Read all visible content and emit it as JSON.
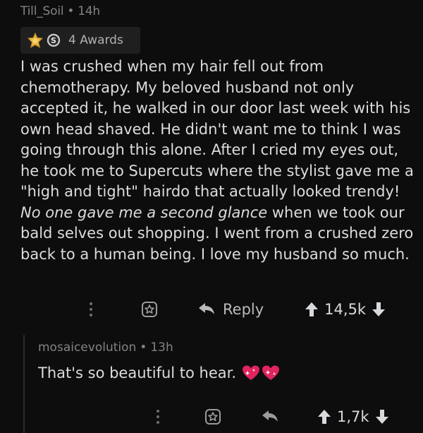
{
  "comment": {
    "author": "Till_Soil",
    "separator": "•",
    "age": "14h",
    "awards_label": "4 Awards",
    "body_part1": "I was crushed when my hair fell out from chemotherapy.  My beloved husband not only accepted it, he walked in our door last week with his own head shaved. He didn't want me to think I was going through this alone. After I cried my eyes out, he took me to Supercuts where the stylist gave me a \"high and tight\" hairdo that actually looked trendy! ",
    "body_italic": "No one gave me a second glance",
    "body_part2": " when we took our bald selves out shopping.  I went from a crushed zero back to a human being.  I love my husband so much.",
    "reply_label": "Reply",
    "score": "14,5k"
  },
  "reply": {
    "author": "mosaicevolution",
    "separator": "•",
    "age": "13h",
    "body": "That's so beautiful to hear.",
    "score": "1,7k"
  },
  "colors": {
    "background": "#0d0d0e",
    "meta_text": "#818384",
    "body_text": "#dcdcdc",
    "heart": "#e0245e"
  },
  "icons": [
    "gold-award-icon",
    "silver-award-icon",
    "more-options-icon",
    "give-award-icon",
    "reply-arrow-icon",
    "upvote-icon",
    "downvote-icon",
    "sparkling-heart-icon"
  ]
}
